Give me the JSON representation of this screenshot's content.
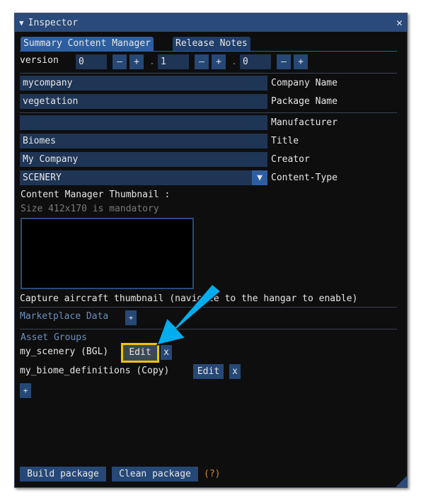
{
  "window": {
    "title": "Inspector",
    "close": "✕",
    "collapse": "▼"
  },
  "tabs": [
    {
      "label": "Summary Content Manager",
      "active": true
    },
    {
      "label": "Release Notes",
      "active": false
    }
  ],
  "version": {
    "label": "version",
    "major": "0",
    "minor": "1",
    "patch": "0",
    "minus": "–",
    "plus": "+",
    "dot": "."
  },
  "fields": {
    "company_name": {
      "value": "mycompany",
      "label": "Company Name"
    },
    "package_name": {
      "value": "vegetation",
      "label": "Package Name"
    },
    "manufacturer": {
      "value": "",
      "label": "Manufacturer"
    },
    "title": {
      "value": "Biomes",
      "label": "Title"
    },
    "creator": {
      "value": "My Company",
      "label": "Creator"
    },
    "content_type": {
      "value": "SCENERY",
      "label": "Content-Type"
    }
  },
  "thumbnail": {
    "label": "Content Manager Thumbnail :",
    "hint": "Size 412x170 is mandatory",
    "capture": "Capture aircraft thumbnail (navigate to the hangar to enable)"
  },
  "marketplace": {
    "label": "Marketplace Data",
    "add": "+"
  },
  "asset_groups": {
    "label": "Asset Groups",
    "items": [
      {
        "name": "my_scenery (BGL)",
        "edit": "Edit",
        "remove": "x",
        "highlighted": true
      },
      {
        "name": "my_biome_definitions (Copy)",
        "edit": "Edit",
        "remove": "x"
      }
    ],
    "add": "+"
  },
  "footer": {
    "build": "Build package",
    "clean": "Clean package",
    "help": "(?)"
  },
  "colors": {
    "highlight": "#f2c200",
    "arrow": "#00aeef"
  }
}
